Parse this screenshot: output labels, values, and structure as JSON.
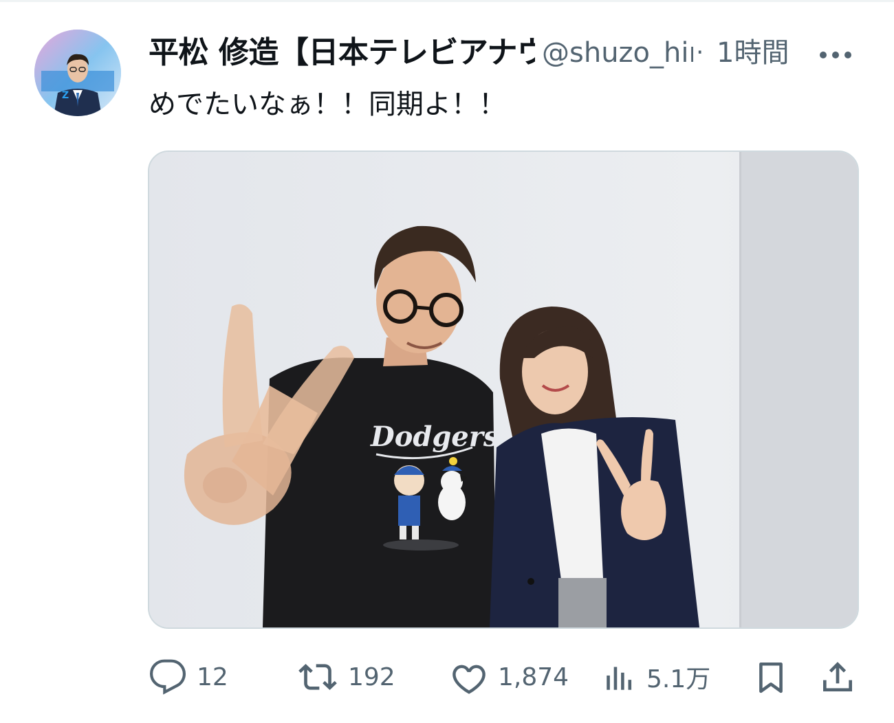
{
  "tweet": {
    "author": {
      "display_name": "平松 修造【日本テレビアナウンサー】",
      "handle": "@shuzo_hiramatsu",
      "avatar": "profile-photo"
    },
    "separator": "·",
    "timestamp": "1時間",
    "text": "めでたいなぁ！！同期よ！！",
    "media": {
      "type": "photo",
      "shirt_text": "Dodgers"
    },
    "more_icon": "more-horizontal-icon"
  },
  "actions": {
    "reply": {
      "icon": "reply-icon",
      "count": "12"
    },
    "retweet": {
      "icon": "retweet-icon",
      "count": "192"
    },
    "like": {
      "icon": "heart-icon",
      "count": "1,874"
    },
    "views": {
      "icon": "views-icon",
      "count": "5.1万"
    },
    "bookmark": {
      "icon": "bookmark-icon"
    },
    "share": {
      "icon": "share-icon"
    }
  },
  "colors": {
    "text_primary": "#0f1419",
    "text_secondary": "#536471",
    "border": "#cfd9de"
  }
}
